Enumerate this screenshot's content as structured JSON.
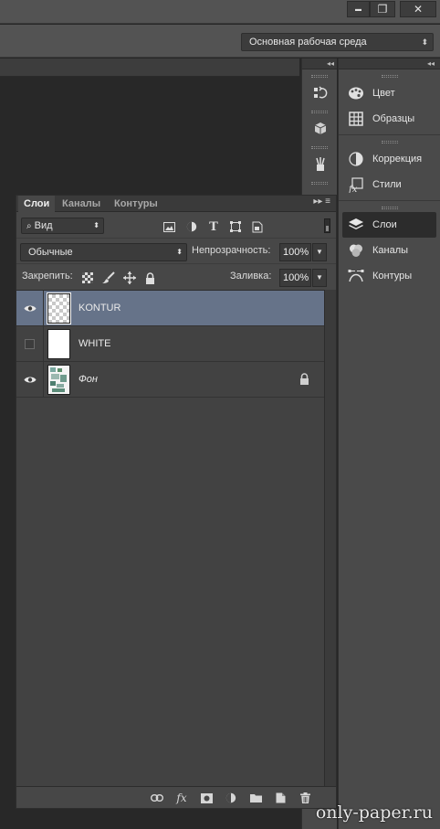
{
  "window": {
    "minimize_glyph": "▬",
    "restore_glyph": "❐",
    "close_glyph": "✕"
  },
  "options_bar": {
    "workspace_label": "Основная рабочая среда"
  },
  "right_dock": {
    "collapse_glyph": "◂◂",
    "groups": [
      {
        "items": [
          {
            "label": "Цвет",
            "icon": "palette-icon"
          },
          {
            "label": "Образцы",
            "icon": "swatches-grid-icon"
          }
        ]
      },
      {
        "items": [
          {
            "label": "Коррекция",
            "icon": "adjustment-circle-icon"
          },
          {
            "label": "Стили",
            "icon": "fx-styles-icon"
          }
        ]
      },
      {
        "items": [
          {
            "label": "Слои",
            "icon": "layers-icon",
            "active": true
          },
          {
            "label": "Каналы",
            "icon": "channels-icon"
          },
          {
            "label": "Контуры",
            "icon": "paths-icon"
          }
        ]
      }
    ]
  },
  "layers_panel": {
    "tabs": [
      "Слои",
      "Каналы",
      "Контуры"
    ],
    "active_tab": "Слои",
    "menu_glyph": "▸▸ ≡",
    "filter_kind": "Вид",
    "blend_mode": "Обычные",
    "opacity_label": "Непрозрачность:",
    "opacity_value": "100%",
    "lock_label": "Закрепить:",
    "fill_label": "Заливка:",
    "fill_value": "100%",
    "layers": [
      {
        "name": "KONTUR",
        "visible": true,
        "selected": true,
        "thumb": "transparent"
      },
      {
        "name": "WHITE",
        "visible": false,
        "selected": false,
        "thumb": "white"
      },
      {
        "name": "Фон",
        "visible": true,
        "selected": false,
        "thumb": "image",
        "locked": true,
        "italic": true
      }
    ],
    "bottom_icons": [
      "link-icon",
      "fx-icon",
      "mask-icon",
      "adjustment-icon",
      "folder-icon",
      "new-layer-icon",
      "trash-icon"
    ],
    "fx_label": "fx"
  },
  "watermark": "only-paper.ru",
  "colors": {
    "selected_row": "#667389",
    "panel_bg": "#474747",
    "canvas_bg": "#282828"
  }
}
